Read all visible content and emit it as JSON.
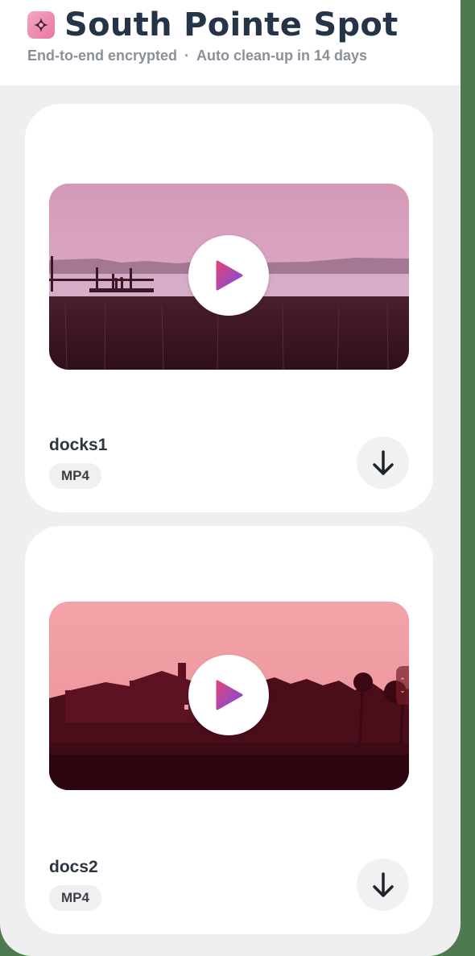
{
  "header": {
    "title": "South Pointe Spot",
    "subtitle_left": "End-to-end encrypted",
    "subtitle_separator": "·",
    "subtitle_right": "Auto clean-up in 14 days",
    "app_icon": "sparkle-icon"
  },
  "files": [
    {
      "name": "docks1",
      "type": "MP4",
      "play_icon": "play-icon",
      "download_icon": "arrow-down-icon"
    },
    {
      "name": "docs2",
      "type": "MP4",
      "play_icon": "play-icon",
      "download_icon": "arrow-down-icon"
    }
  ],
  "colors": {
    "title": "#263447",
    "accent_gradient_start": "#e0447a",
    "accent_gradient_end": "#7b4ce0",
    "card_background": "#ffffff",
    "page_background": "#efefef"
  }
}
